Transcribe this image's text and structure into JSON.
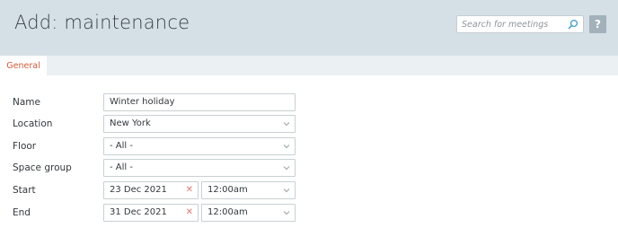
{
  "header": {
    "title": "Add: maintenance",
    "search_placeholder": "Search for meetings",
    "help_label": "?"
  },
  "tabs": [
    {
      "label": "General",
      "active": true
    }
  ],
  "form": {
    "name": {
      "label": "Name",
      "value": "Winter holiday"
    },
    "location": {
      "label": "Location",
      "value": "New York"
    },
    "floor": {
      "label": "Floor",
      "value": "- All -"
    },
    "space_group": {
      "label": "Space group",
      "value": "- All -"
    },
    "start": {
      "label": "Start",
      "date": "23 Dec 2021",
      "time": "12:00am"
    },
    "end": {
      "label": "End",
      "date": "31 Dec 2021",
      "time": "12:00am"
    }
  },
  "colors": {
    "header_bg": "#d5e0e6",
    "tab_active_text": "#d45b3c",
    "clear_icon": "#e07a6c"
  }
}
